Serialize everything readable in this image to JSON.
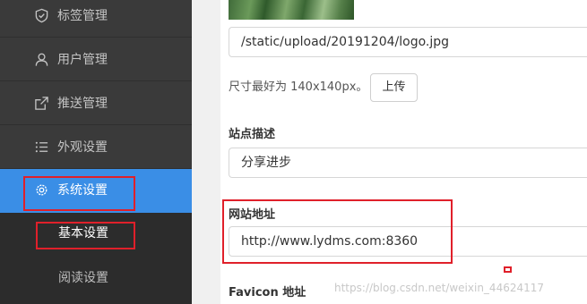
{
  "sidebar": {
    "items": [
      {
        "label": "标签管理",
        "icon": "tag-icon"
      },
      {
        "label": "用户管理",
        "icon": "user-icon"
      },
      {
        "label": "推送管理",
        "icon": "share-icon"
      },
      {
        "label": "外观设置",
        "icon": "list-icon"
      },
      {
        "label": "系统设置",
        "icon": "gear-icon",
        "active": true
      }
    ],
    "subitems": [
      {
        "label": "基本设置",
        "active": true
      },
      {
        "label": "阅读设置"
      }
    ]
  },
  "form": {
    "logo": {
      "value": "/static/upload/20191204/logo.jpg",
      "hint": "尺寸最好为 140x140px。",
      "upload_label": "上传"
    },
    "site_description": {
      "label": "站点描述",
      "value": "分享进步"
    },
    "site_url": {
      "label": "网站地址",
      "value": "http://www.lydms.com:8360"
    },
    "favicon": {
      "label": "Favicon 地址"
    }
  },
  "watermark": "https://blog.csdn.net/weixin_44624117",
  "colors": {
    "sidebar_bg": "#3a3a3a",
    "active_bg": "#3a8ee6",
    "annotation_red": "#e0202a"
  }
}
